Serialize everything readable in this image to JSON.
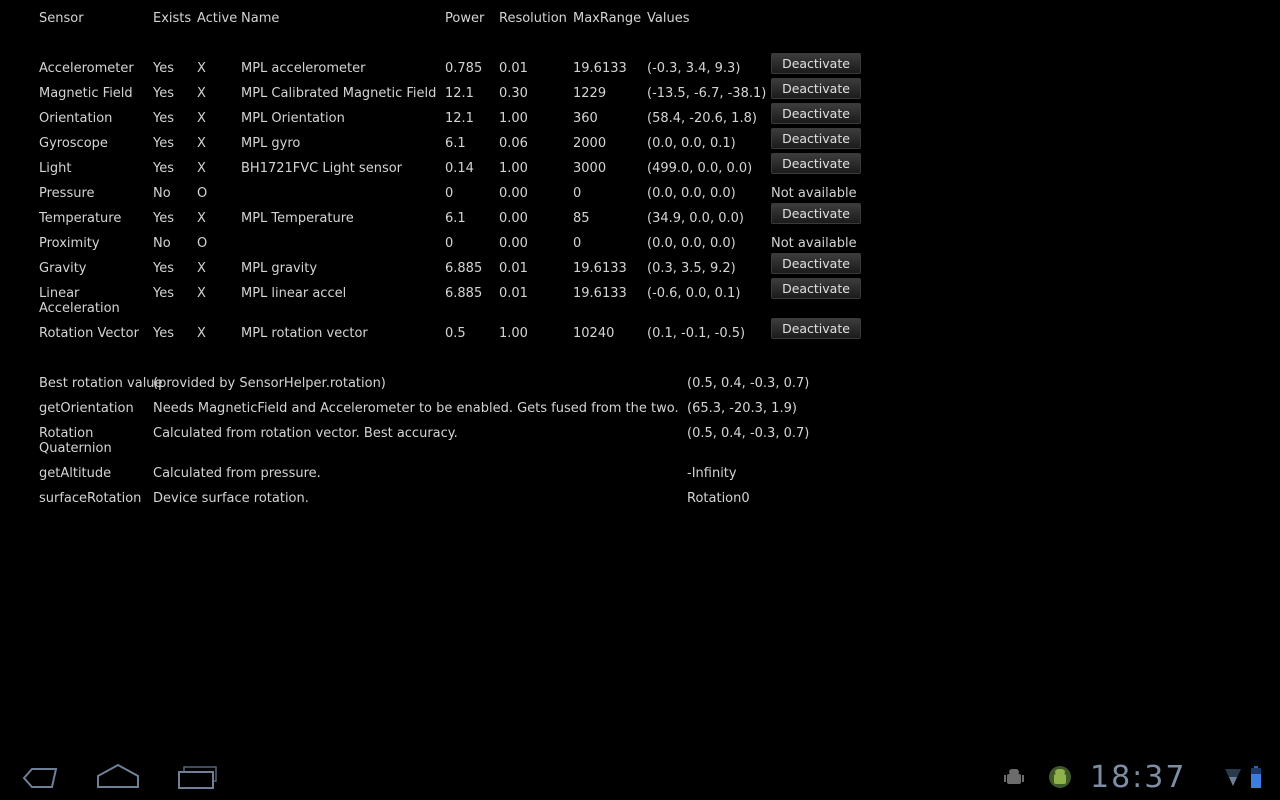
{
  "header": {
    "sensor": "Sensor",
    "exists": "Exists",
    "active": "Active",
    "name": "Name",
    "power": "Power",
    "resolution": "Resolution",
    "maxrange": "MaxRange",
    "values": "Values"
  },
  "sensors": [
    {
      "sensor": "Accelerometer",
      "exists": "Yes",
      "active": "X",
      "name": "MPL accelerometer",
      "power": "0.785",
      "resolution": "0.01",
      "maxrange": "19.6133",
      "values": "(-0.3, 3.4, 9.3)",
      "action": "Deactivate"
    },
    {
      "sensor": "Magnetic Field",
      "exists": "Yes",
      "active": "X",
      "name": "MPL Calibrated Magnetic Field",
      "power": "12.1",
      "resolution": "0.30",
      "maxrange": "1229",
      "values": "(-13.5, -6.7, -38.1)",
      "action": "Deactivate"
    },
    {
      "sensor": "Orientation",
      "exists": "Yes",
      "active": "X",
      "name": "MPL Orientation",
      "power": "12.1",
      "resolution": "1.00",
      "maxrange": "360",
      "values": "(58.4, -20.6, 1.8)",
      "action": "Deactivate"
    },
    {
      "sensor": "Gyroscope",
      "exists": "Yes",
      "active": "X",
      "name": "MPL gyro",
      "power": "6.1",
      "resolution": "0.06",
      "maxrange": "2000",
      "values": "(0.0, 0.0, 0.1)",
      "action": "Deactivate"
    },
    {
      "sensor": "Light",
      "exists": "Yes",
      "active": "X",
      "name": "BH1721FVC Light sensor",
      "power": "0.14",
      "resolution": "1.00",
      "maxrange": "3000",
      "values": "(499.0, 0.0, 0.0)",
      "action": "Deactivate"
    },
    {
      "sensor": "Pressure",
      "exists": "No",
      "active": "O",
      "name": "",
      "power": "0",
      "resolution": "0.00",
      "maxrange": "0",
      "values": "(0.0, 0.0, 0.0)",
      "status": "Not available"
    },
    {
      "sensor": "Temperature",
      "exists": "Yes",
      "active": "X",
      "name": "MPL Temperature",
      "power": "6.1",
      "resolution": "0.00",
      "maxrange": "85",
      "values": "(34.9, 0.0, 0.0)",
      "action": "Deactivate"
    },
    {
      "sensor": "Proximity",
      "exists": "No",
      "active": "O",
      "name": "",
      "power": "0",
      "resolution": "0.00",
      "maxrange": "0",
      "values": "(0.0, 0.0, 0.0)",
      "status": "Not available"
    },
    {
      "sensor": "Gravity",
      "exists": "Yes",
      "active": "X",
      "name": "MPL gravity",
      "power": "6.885",
      "resolution": "0.01",
      "maxrange": "19.6133",
      "values": "(0.3, 3.5, 9.2)",
      "action": "Deactivate"
    },
    {
      "sensor": "Linear Acceleration",
      "exists": "Yes",
      "active": "X",
      "name": "MPL linear accel",
      "power": "6.885",
      "resolution": "0.01",
      "maxrange": "19.6133",
      "values": "(-0.6, 0.0, 0.1)",
      "action": "Deactivate"
    },
    {
      "sensor": "Rotation Vector",
      "exists": "Yes",
      "active": "X",
      "name": "MPL rotation vector",
      "power": "0.5",
      "resolution": "1.00",
      "maxrange": "10240",
      "values": "(0.1, -0.1, -0.5)",
      "action": "Deactivate"
    }
  ],
  "derived": [
    {
      "label": "Best rotation value",
      "desc": "(provided by SensorHelper.rotation)",
      "value": "(0.5, 0.4, -0.3, 0.7)"
    },
    {
      "label": "getOrientation",
      "desc": "Needs MagneticField and Accelerometer to be enabled. Gets fused from the two.",
      "value": "(65.3, -20.3, 1.9)"
    },
    {
      "label": "Rotation Quaternion",
      "desc": "Calculated from rotation vector. Best accuracy.",
      "value": "(0.5, 0.4, -0.3, 0.7)"
    },
    {
      "label": "getAltitude",
      "desc": "Calculated from pressure.",
      "value": "-Infinity"
    },
    {
      "label": "surfaceRotation",
      "desc": "Device surface rotation.",
      "value": "Rotation0"
    }
  ],
  "system_bar": {
    "clock": "18:37",
    "icons": [
      "back-icon",
      "home-icon",
      "recent-apps-icon",
      "usb-debug-icon",
      "android-notification-icon",
      "signal-icon",
      "battery-icon"
    ],
    "accent_color": "#7d8da3"
  }
}
